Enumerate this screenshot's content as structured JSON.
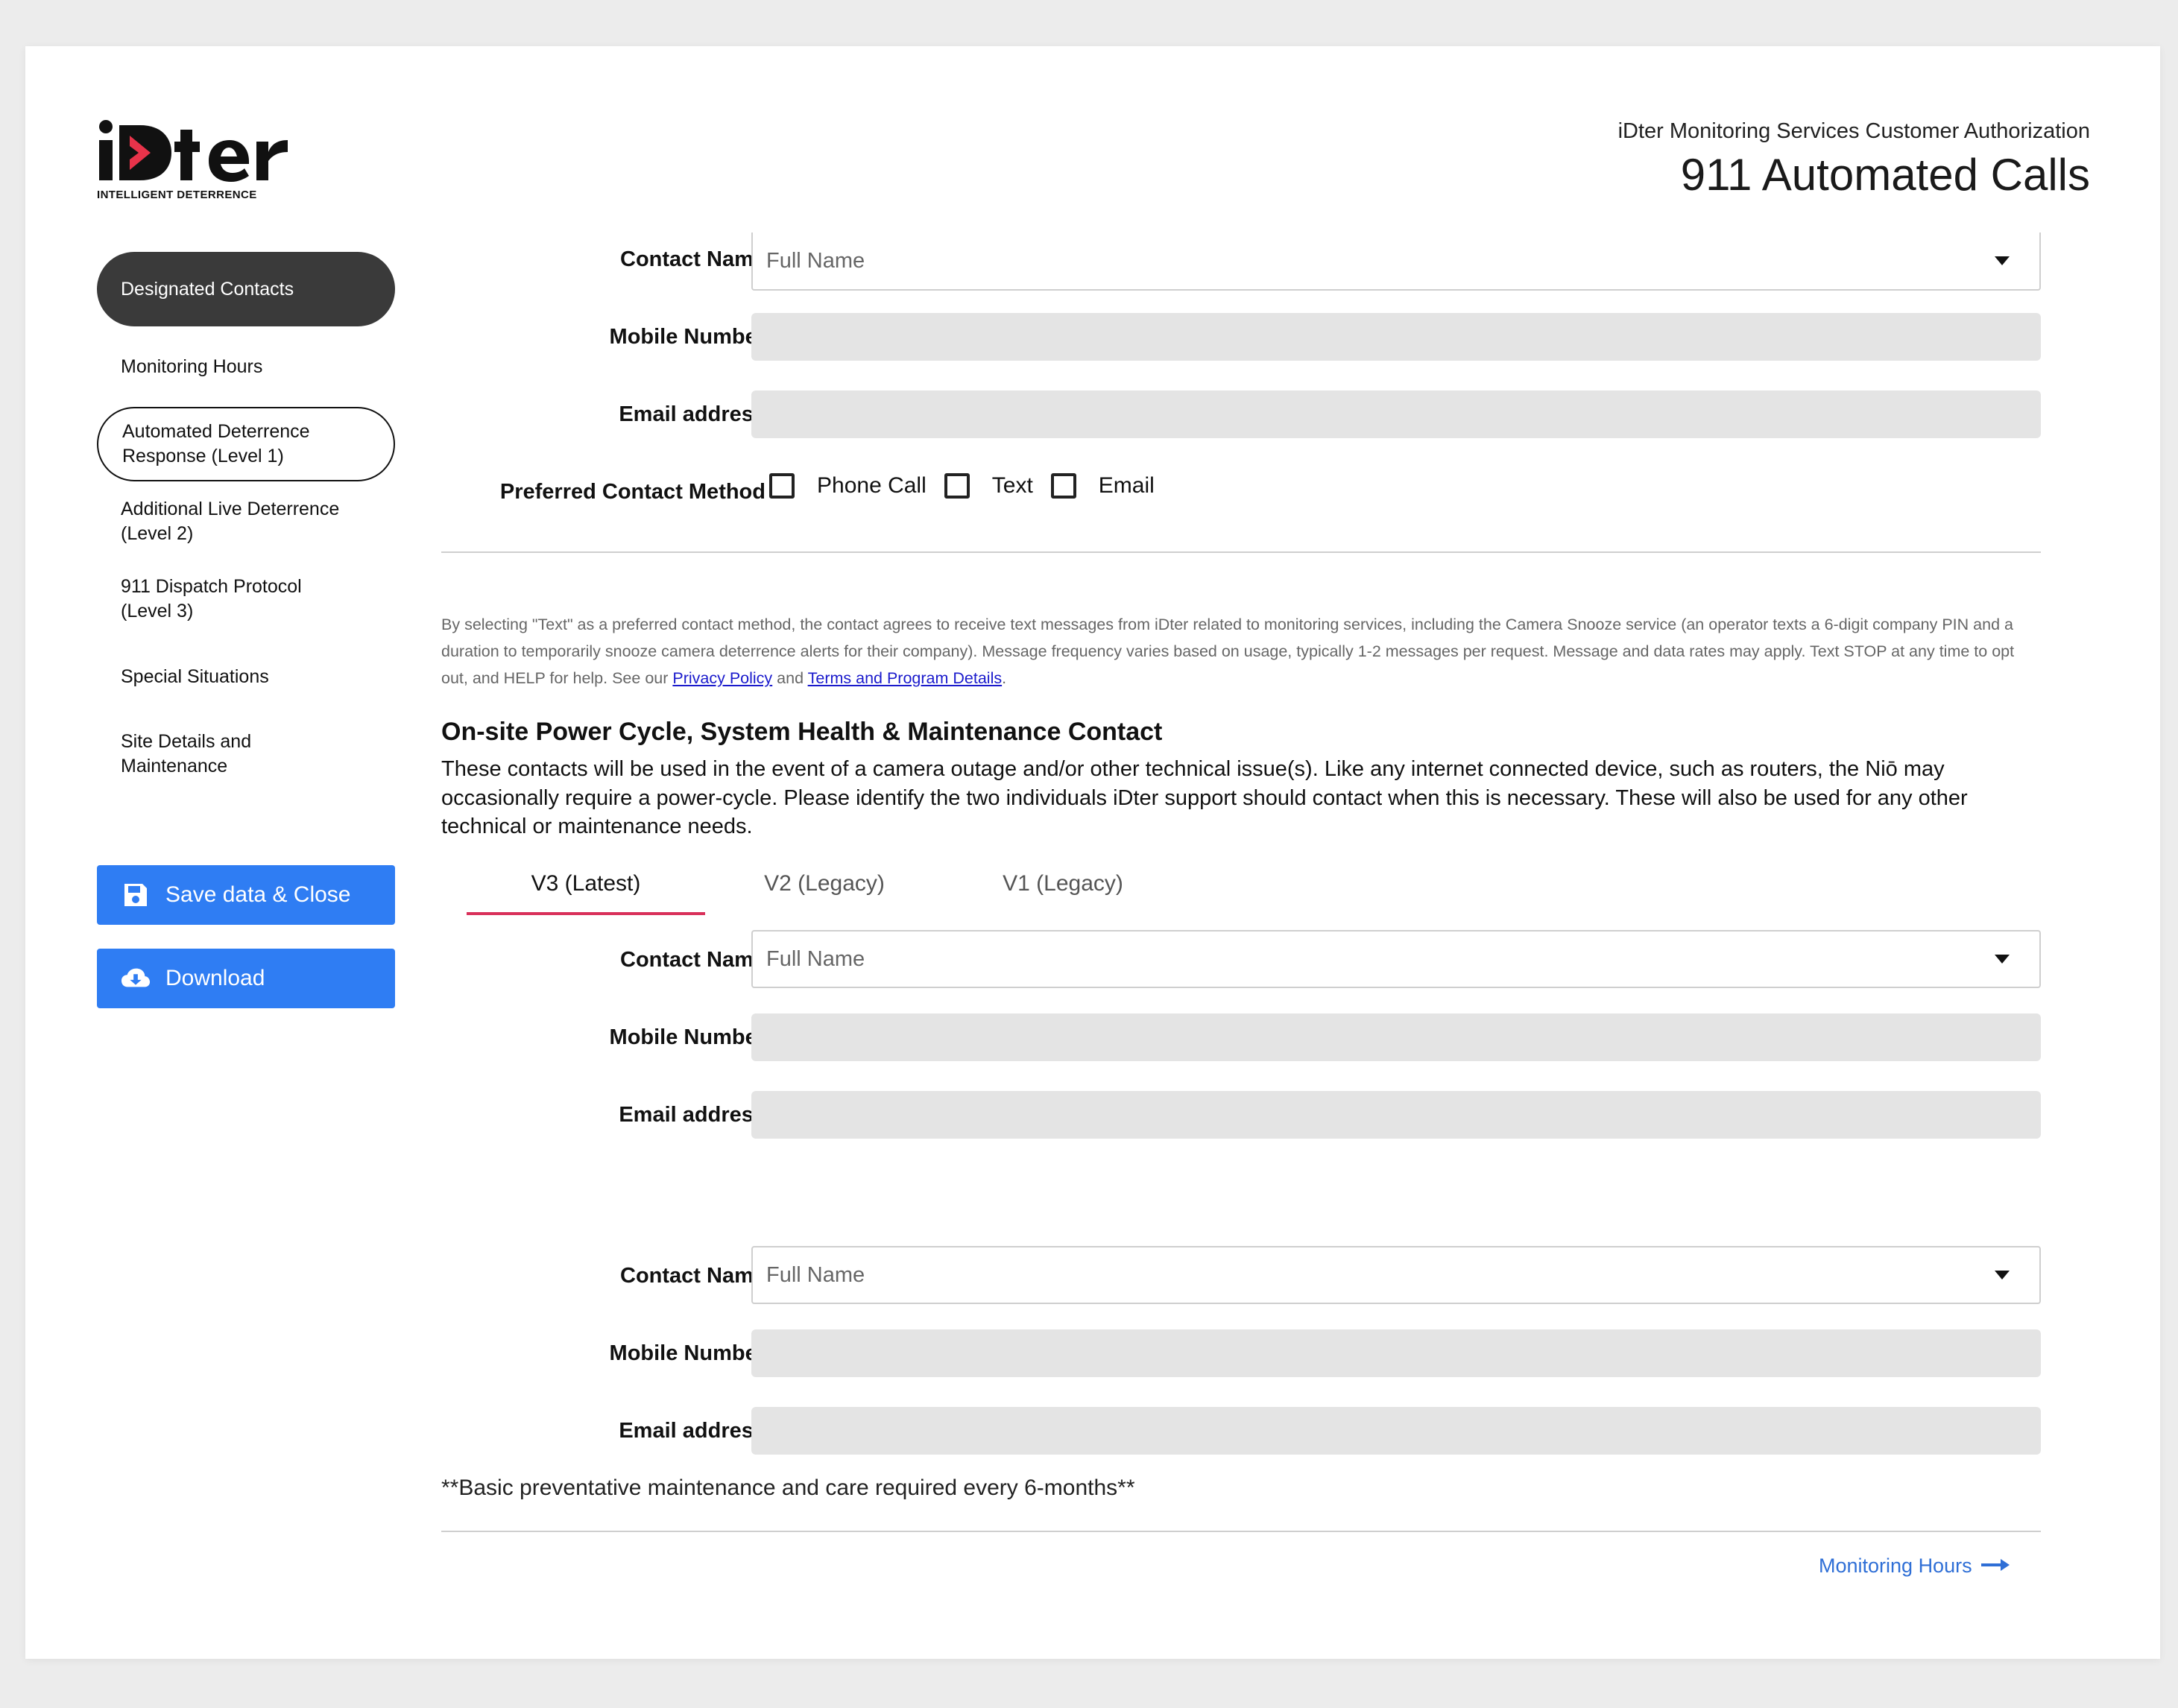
{
  "brand": {
    "logo_text": "iDter",
    "tagline": "INTELLIGENT DETERRENCE",
    "accent_color": "#e8334a"
  },
  "header": {
    "subtitle": "iDter Monitoring Services Customer Authorization",
    "title": "911 Automated Calls"
  },
  "sidebar": {
    "items": [
      {
        "label": "Designated Contacts",
        "state": "active"
      },
      {
        "label": "Monitoring Hours",
        "state": "default"
      },
      {
        "label": "Automated Deterrence Response (Level 1)",
        "state": "outlined"
      },
      {
        "label": "Additional Live Deterrence (Level 2)",
        "state": "default"
      },
      {
        "label": "911 Dispatch Protocol (Level 3)",
        "state": "default"
      },
      {
        "label": "Special Situations",
        "state": "default"
      },
      {
        "label": "Site Details and Maintenance",
        "state": "default"
      }
    ],
    "save_button": {
      "label": "Save data & Close",
      "icon": "floppy-disk-icon"
    },
    "download_button": {
      "label": "Download",
      "icon": "cloud-download-icon"
    },
    "button_color": "#2f7df3"
  },
  "top_contact": {
    "contact_name_label": "Contact Name",
    "contact_name_placeholder": "Full Name",
    "mobile_label": "Mobile Number",
    "email_label": "Email address",
    "preferred_label": "Preferred Contact Method",
    "methods": [
      {
        "label": "Phone Call",
        "checked": false
      },
      {
        "label": "Text",
        "checked": false
      },
      {
        "label": "Email",
        "checked": false
      }
    ]
  },
  "disclaimer": {
    "text_before": "By selecting \"Text\" as a preferred contact method, the contact agrees to receive text messages from iDter related to monitoring services, including the Camera Snooze service (an operator texts a 6-digit company PIN and a duration to temporarily snooze camera deterrence alerts for their company). Message frequency varies based on usage, typically 1-2 messages per request. Message and data rates may apply. Text STOP at any time to opt out, and HELP for help. See our ",
    "privacy_link": "Privacy Policy",
    "and_text": " and ",
    "terms_link": "Terms and Program Details",
    "end_text": "."
  },
  "maintenance": {
    "title": "On-site Power Cycle, System Health & Maintenance Contact",
    "description": "These contacts will be used in the event of a camera outage and/or other technical issue(s). Like any internet connected device, such as routers, the Niō may occasionally require a power-cycle. Please identify the two individuals iDter support should contact when this is necessary. These will also be used for any other technical or maintenance needs.",
    "tabs": [
      {
        "label": "V3 (Latest)",
        "active": true
      },
      {
        "label": "V2 (Legacy)",
        "active": false
      },
      {
        "label": "V1 (Legacy)",
        "active": false
      }
    ],
    "contact1": {
      "contact_name_label": "Contact Name",
      "contact_name_placeholder": "Full Name",
      "mobile_label": "Mobile Number",
      "email_label": "Email address"
    },
    "contact2": {
      "contact_name_label": "Contact Name",
      "contact_name_placeholder": "Full Name",
      "mobile_label": "Mobile Number",
      "email_label": "Email address"
    },
    "note": "**Basic preventative maintenance and care required every 6-months**",
    "tab_accent_color": "#d9305a"
  },
  "footer": {
    "next_link": "Monitoring Hours",
    "next_icon": "arrow-right-icon"
  }
}
